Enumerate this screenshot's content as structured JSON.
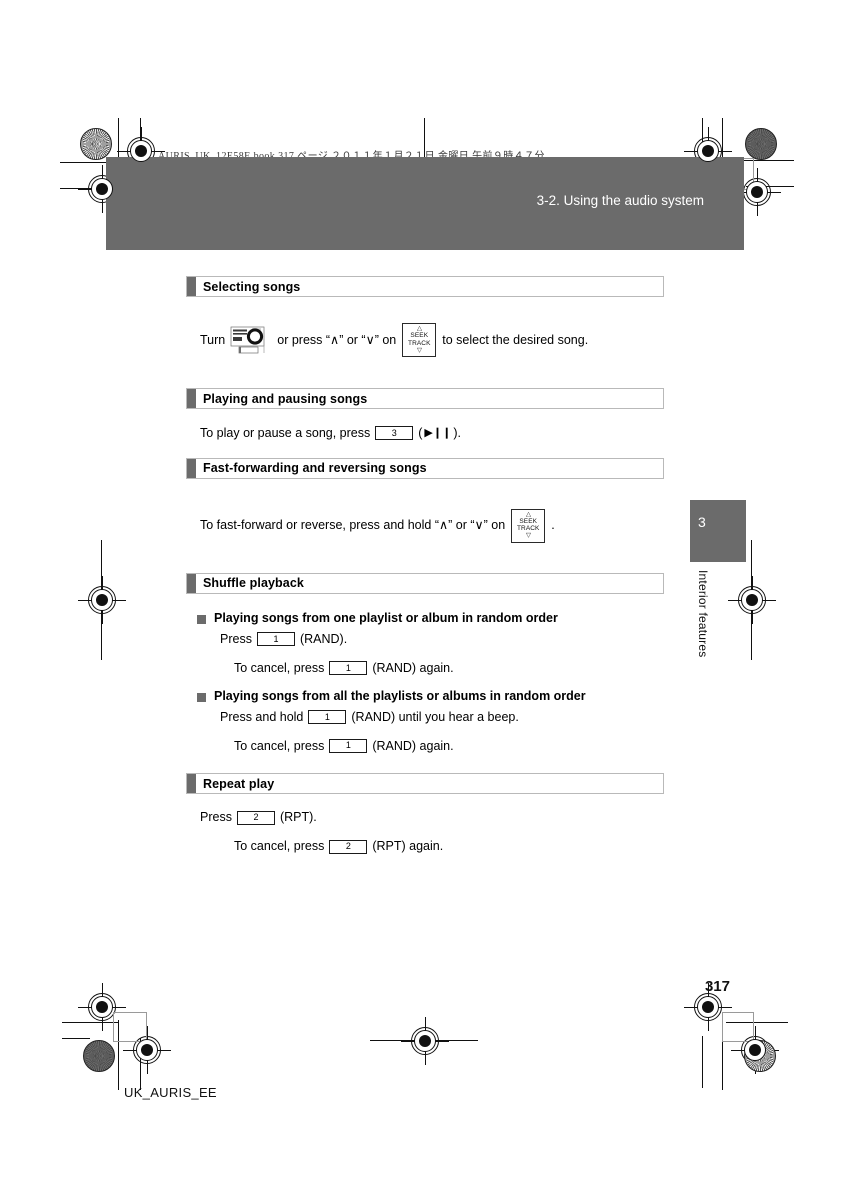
{
  "print": {
    "book_line": "AURIS_UK_12E58E.book   317 ページ   ２０１１年１月２１日   金曜日   午前９時４７分",
    "footer_code": "UK_AURIS_EE",
    "page_number": "317"
  },
  "banner": {
    "title": "3-2. Using the audio system",
    "color": "#6b6b6b"
  },
  "chapter_tab": {
    "number": "3",
    "label": "Interior features",
    "color": "#6b6b6b"
  },
  "icons": {
    "seek_button": {
      "up_arrow": "⌃",
      "seek_label": "SEEK",
      "track_label": "TRACK",
      "down_arrow": "⌄"
    },
    "knob": "audio-knob-icon",
    "play_pause_glyph": "▶❙❙"
  },
  "sections": [
    {
      "id": "selecting-songs",
      "title": "Selecting songs",
      "lines": [
        {
          "kind": "knob-seek",
          "pre": "Turn",
          "mid": "or press “∧” or “∨” on",
          "post": "to select the desired song."
        }
      ]
    },
    {
      "id": "playing-pausing",
      "title": "Playing and pausing songs",
      "lines": [
        {
          "kind": "key",
          "pre": "To play or pause a song, press",
          "key": "3",
          "post_open": "(",
          "glyph": "▶❙❙",
          "post_close": ").",
          "suffix": ""
        }
      ]
    },
    {
      "id": "fast-forward",
      "title": "Fast-forwarding and reversing songs",
      "lines": [
        {
          "kind": "seek",
          "pre": "To fast-forward or reverse, press and hold “∧” or “∨” on",
          "post": "."
        }
      ]
    },
    {
      "id": "shuffle",
      "title": "Shuffle playback",
      "subsections": [
        {
          "heading": "Playing songs from one playlist or album in random order",
          "lines": [
            {
              "pre": "Press",
              "key": "1",
              "post": "(RAND).",
              "indent": 1
            },
            {
              "pre": "To cancel, press",
              "key": "1",
              "post": "(RAND) again.",
              "indent": 2
            }
          ]
        },
        {
          "heading": "Playing songs from all the playlists or albums in random order",
          "lines": [
            {
              "pre": "Press and hold",
              "key": "1",
              "post": "(RAND) until you hear a beep.",
              "indent": 1
            },
            {
              "pre": "To cancel, press",
              "key": "1",
              "post": "(RAND) again.",
              "indent": 2
            }
          ]
        }
      ]
    },
    {
      "id": "repeat",
      "title": "Repeat play",
      "lines": [
        {
          "pre": "Press",
          "key": "2",
          "post": "(RPT).",
          "indent": 1
        },
        {
          "pre": "To cancel, press",
          "key": "2",
          "post": "(RPT) again.",
          "indent": 2
        }
      ]
    }
  ]
}
